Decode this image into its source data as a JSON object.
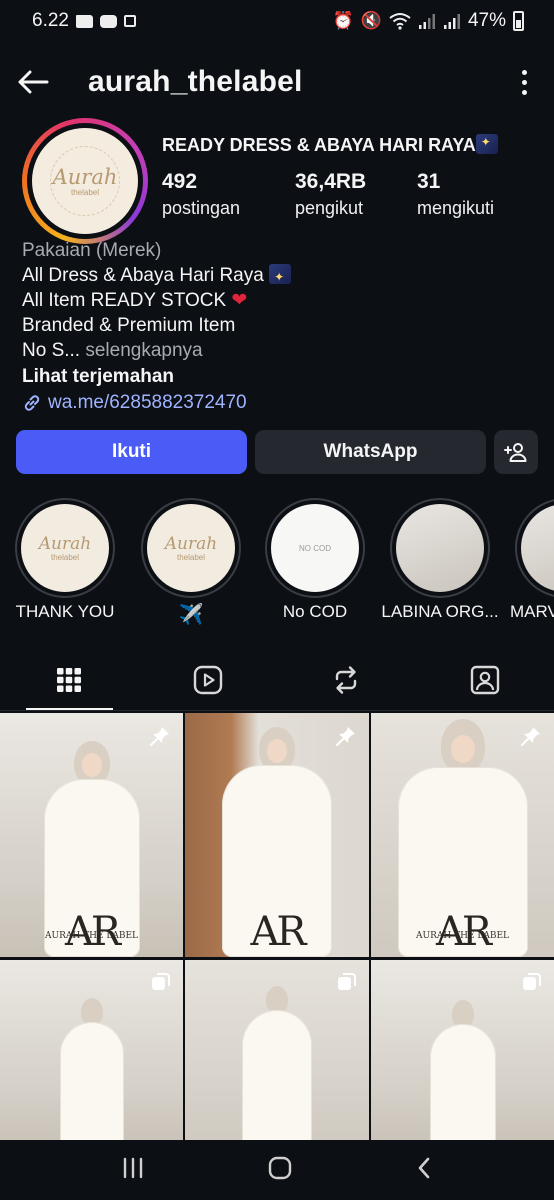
{
  "status_bar": {
    "time": "6.22",
    "battery": "47%"
  },
  "header": {
    "username": "aurah_thelabel"
  },
  "profile": {
    "avatar_logo_text": "Aurah",
    "avatar_logo_sub": "thelabel",
    "name": "READY DRESS & ABAYA HARI RAYA",
    "stats": [
      {
        "value": "492",
        "label": "postingan"
      },
      {
        "value": "36,4RB",
        "label": "pengikut"
      },
      {
        "value": "31",
        "label": "mengikuti"
      }
    ],
    "category": "Pakaian (Merek)",
    "bio_lines": [
      "All Dress & Abaya Hari Raya",
      "All Item READY STOCK",
      "Branded & Premium Item",
      "No S..."
    ],
    "more_label": "selengkapnya",
    "translate_label": "Lihat terjemahan",
    "link": "wa.me/6285882372470"
  },
  "actions": {
    "follow_label": "Ikuti",
    "whatsapp_label": "WhatsApp"
  },
  "highlights": [
    {
      "label": "THANK YOU",
      "kind": "logo"
    },
    {
      "label": "✈️",
      "kind": "logo"
    },
    {
      "label": "No COD",
      "kind": "doc",
      "doc_title": "NO COD"
    },
    {
      "label": "LABINA ORG...",
      "kind": "photo"
    },
    {
      "label": "MARV",
      "kind": "photo"
    }
  ],
  "grid_posts": [
    {
      "watermark": "AR",
      "watermark_sub": "AURAH THE LABEL",
      "badge": "pin"
    },
    {
      "watermark": "AR",
      "watermark_sub": "",
      "badge": "pin"
    },
    {
      "watermark": "AR",
      "watermark_sub": "AURAH THE LABEL",
      "badge": "pin"
    },
    {
      "watermark": "",
      "watermark_sub": "",
      "badge": "multi"
    },
    {
      "watermark": "",
      "watermark_sub": "",
      "badge": "multi"
    },
    {
      "watermark": "",
      "watermark_sub": "",
      "badge": "multi"
    }
  ]
}
